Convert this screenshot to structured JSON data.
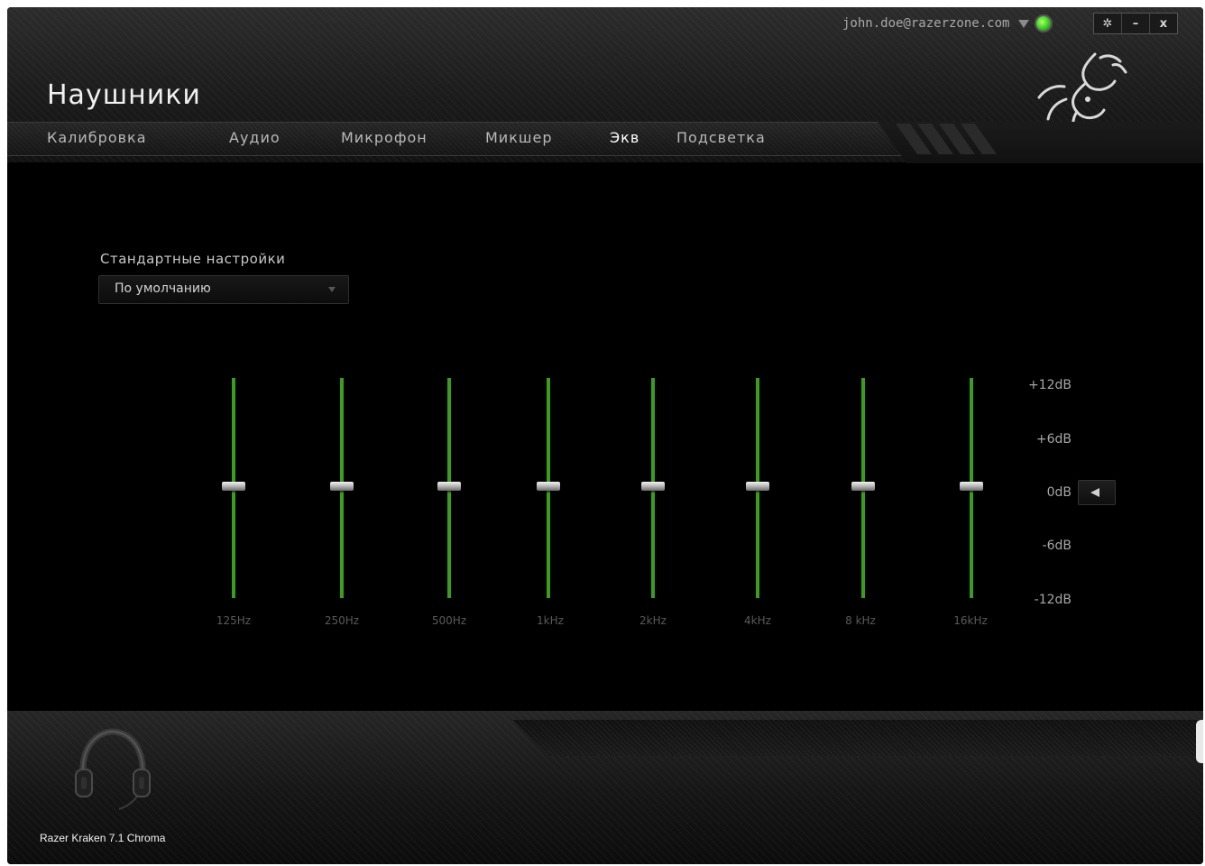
{
  "header": {
    "title": "Наушники",
    "account_email": "john.doe@razerzone.com",
    "window_controls": {
      "settings_icon": "gear-icon",
      "minimize_label": "–",
      "close_label": "x"
    }
  },
  "tabs": [
    {
      "label": "Калибровка",
      "active": false
    },
    {
      "label": "Аудио",
      "active": false
    },
    {
      "label": "Микрофон",
      "active": false
    },
    {
      "label": "Микшер",
      "active": false
    },
    {
      "label": "Экв",
      "active": true
    },
    {
      "label": "Подсветка",
      "active": false
    }
  ],
  "presets": {
    "label": "Стандартные настройки",
    "selected": "По умолчанию"
  },
  "equalizer": {
    "bands": [
      {
        "freq": "125Hz",
        "gain_db": 0
      },
      {
        "freq": "250Hz",
        "gain_db": 0
      },
      {
        "freq": "500Hz",
        "gain_db": 0
      },
      {
        "freq": "1kHz",
        "gain_db": 0
      },
      {
        "freq": "2kHz",
        "gain_db": 0
      },
      {
        "freq": "4kHz",
        "gain_db": 0
      },
      {
        "freq": "8 kHz",
        "gain_db": 0
      },
      {
        "freq": "16kHz",
        "gain_db": 0
      }
    ],
    "scale": [
      "+12dB",
      "+6dB",
      "0dB",
      "-6dB",
      "-12dB"
    ],
    "range_db": [
      -12,
      12
    ]
  },
  "device": {
    "name": "Razer Kraken 7.1 Chroma"
  },
  "colors": {
    "accent": "#44d62c",
    "slider_track": "#3a9d1d",
    "background": "#000000"
  }
}
